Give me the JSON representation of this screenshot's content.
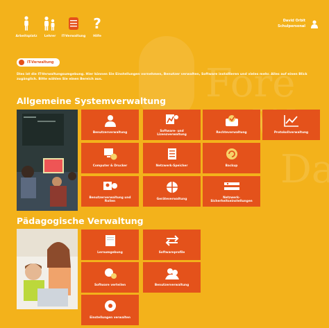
{
  "nav": {
    "items": [
      {
        "label": "Arbeitsplatz",
        "icon": "person-standing-icon"
      },
      {
        "label": "Lehrer",
        "icon": "teacher-icon"
      },
      {
        "label": "IT-Verwaltung",
        "icon": "server-icon"
      },
      {
        "label": "Hilfe",
        "icon": "help-icon"
      }
    ]
  },
  "user": {
    "name": "David Orbit",
    "role": "Schulpersonal",
    "icon": "user-icon"
  },
  "breadcrumb": {
    "label": "IT-Verwaltung",
    "icon": "globe-icon"
  },
  "intro": "Dies ist die IT-Verwaltungsumgebung. Hier können Sie Einstellungen vornehmen, Benutzer verwalten, Software installieren und vieles mehr. Alles auf einen Blick zugänglich. Bitte wählen Sie einen Bereich aus.",
  "background": {
    "text1": "Fore",
    "text2": "Wo",
    "text3": "Da"
  },
  "sections": {
    "system": {
      "title": "Allgemeine Systemverwaltung",
      "tiles": [
        {
          "label": "Benutzerverwaltung",
          "icon": "user-icon"
        },
        {
          "label": "Software- und Lizenzverwaltung",
          "icon": "software-icon"
        },
        {
          "label": "Rechteverwaltung",
          "icon": "rights-icon"
        },
        {
          "label": "Protokollverwaltung",
          "icon": "chart-icon"
        },
        {
          "label": "Computer & Drucker",
          "icon": "computer-icon"
        },
        {
          "label": "Netzwerk-Speicher",
          "icon": "storage-icon"
        },
        {
          "label": "Backup",
          "icon": "backup-icon"
        },
        {
          "label": "Benutzerverwaltung und Rollen",
          "icon": "roles-icon"
        },
        {
          "label": "Geräteverwaltung",
          "icon": "device-icon"
        },
        {
          "label": "Netzwerk-Sicherheitseinstellungen",
          "icon": "network-icon"
        }
      ]
    },
    "paed": {
      "title": "Pädagogische Verwaltung",
      "tiles": [
        {
          "label": "Lernumgebung",
          "icon": "document-icon"
        },
        {
          "label": "Softwareprofile",
          "icon": "profile-icon"
        },
        {
          "label": "Software verteilen",
          "icon": "distribute-icon"
        },
        {
          "label": "Benutzerverwaltung",
          "icon": "users-icon"
        },
        {
          "label": "Einstellungen verwalten",
          "icon": "settings-icon"
        }
      ]
    }
  },
  "colors": {
    "background": "#f3b21b",
    "tile": "#e4521b",
    "tile_icon": "#ffffff"
  }
}
